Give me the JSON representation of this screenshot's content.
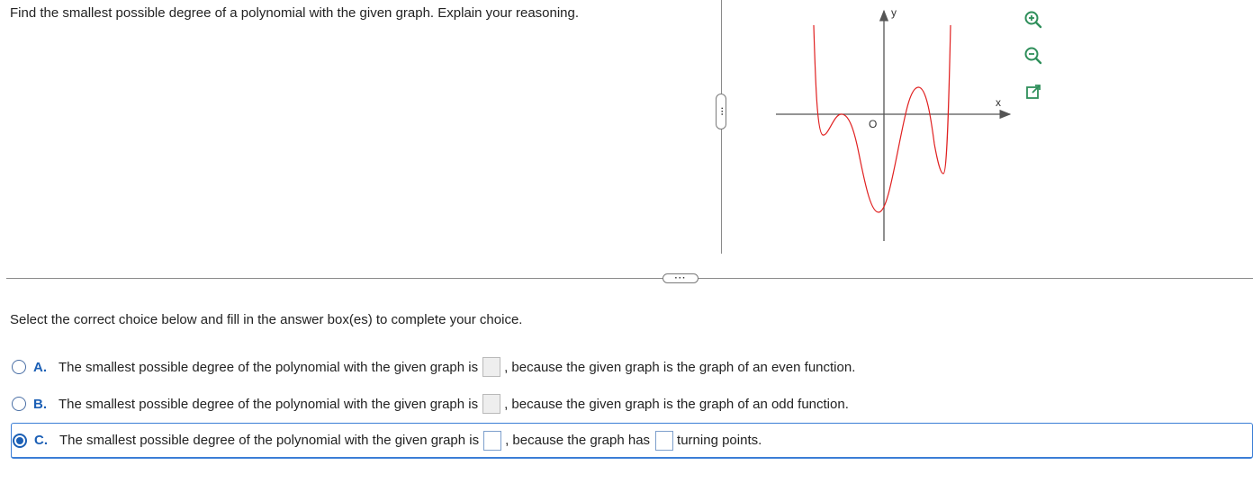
{
  "question": {
    "text": "Find the smallest possible degree of a polynomial with the given graph. Explain your reasoning."
  },
  "graph": {
    "y_label": "y",
    "x_label": "x",
    "origin_label": "O"
  },
  "tools": [
    "zoom-in-icon",
    "zoom-out-icon",
    "open-external-icon"
  ],
  "instruction": {
    "text": "Select the correct choice below and fill in the answer box(es) to complete your choice."
  },
  "choices": [
    {
      "letter": "A.",
      "text_before": "The smallest possible degree of the polynomial with the given graph is",
      "text_after": ", because the given graph is the graph of an even function.",
      "selected": false
    },
    {
      "letter": "B.",
      "text_before": "The smallest possible degree of the polynomial with the given graph is",
      "text_after": ", because the given graph is the graph of an odd function.",
      "selected": false
    },
    {
      "letter": "C.",
      "text_before": "The smallest possible degree of the polynomial with the given graph is",
      "text_middle": ", because the graph has",
      "text_after": "turning points.",
      "selected": true
    }
  ],
  "colors": {
    "curve": "#e02020",
    "accent": "#1b5fb5",
    "selected_border": "#3b7ed6"
  }
}
